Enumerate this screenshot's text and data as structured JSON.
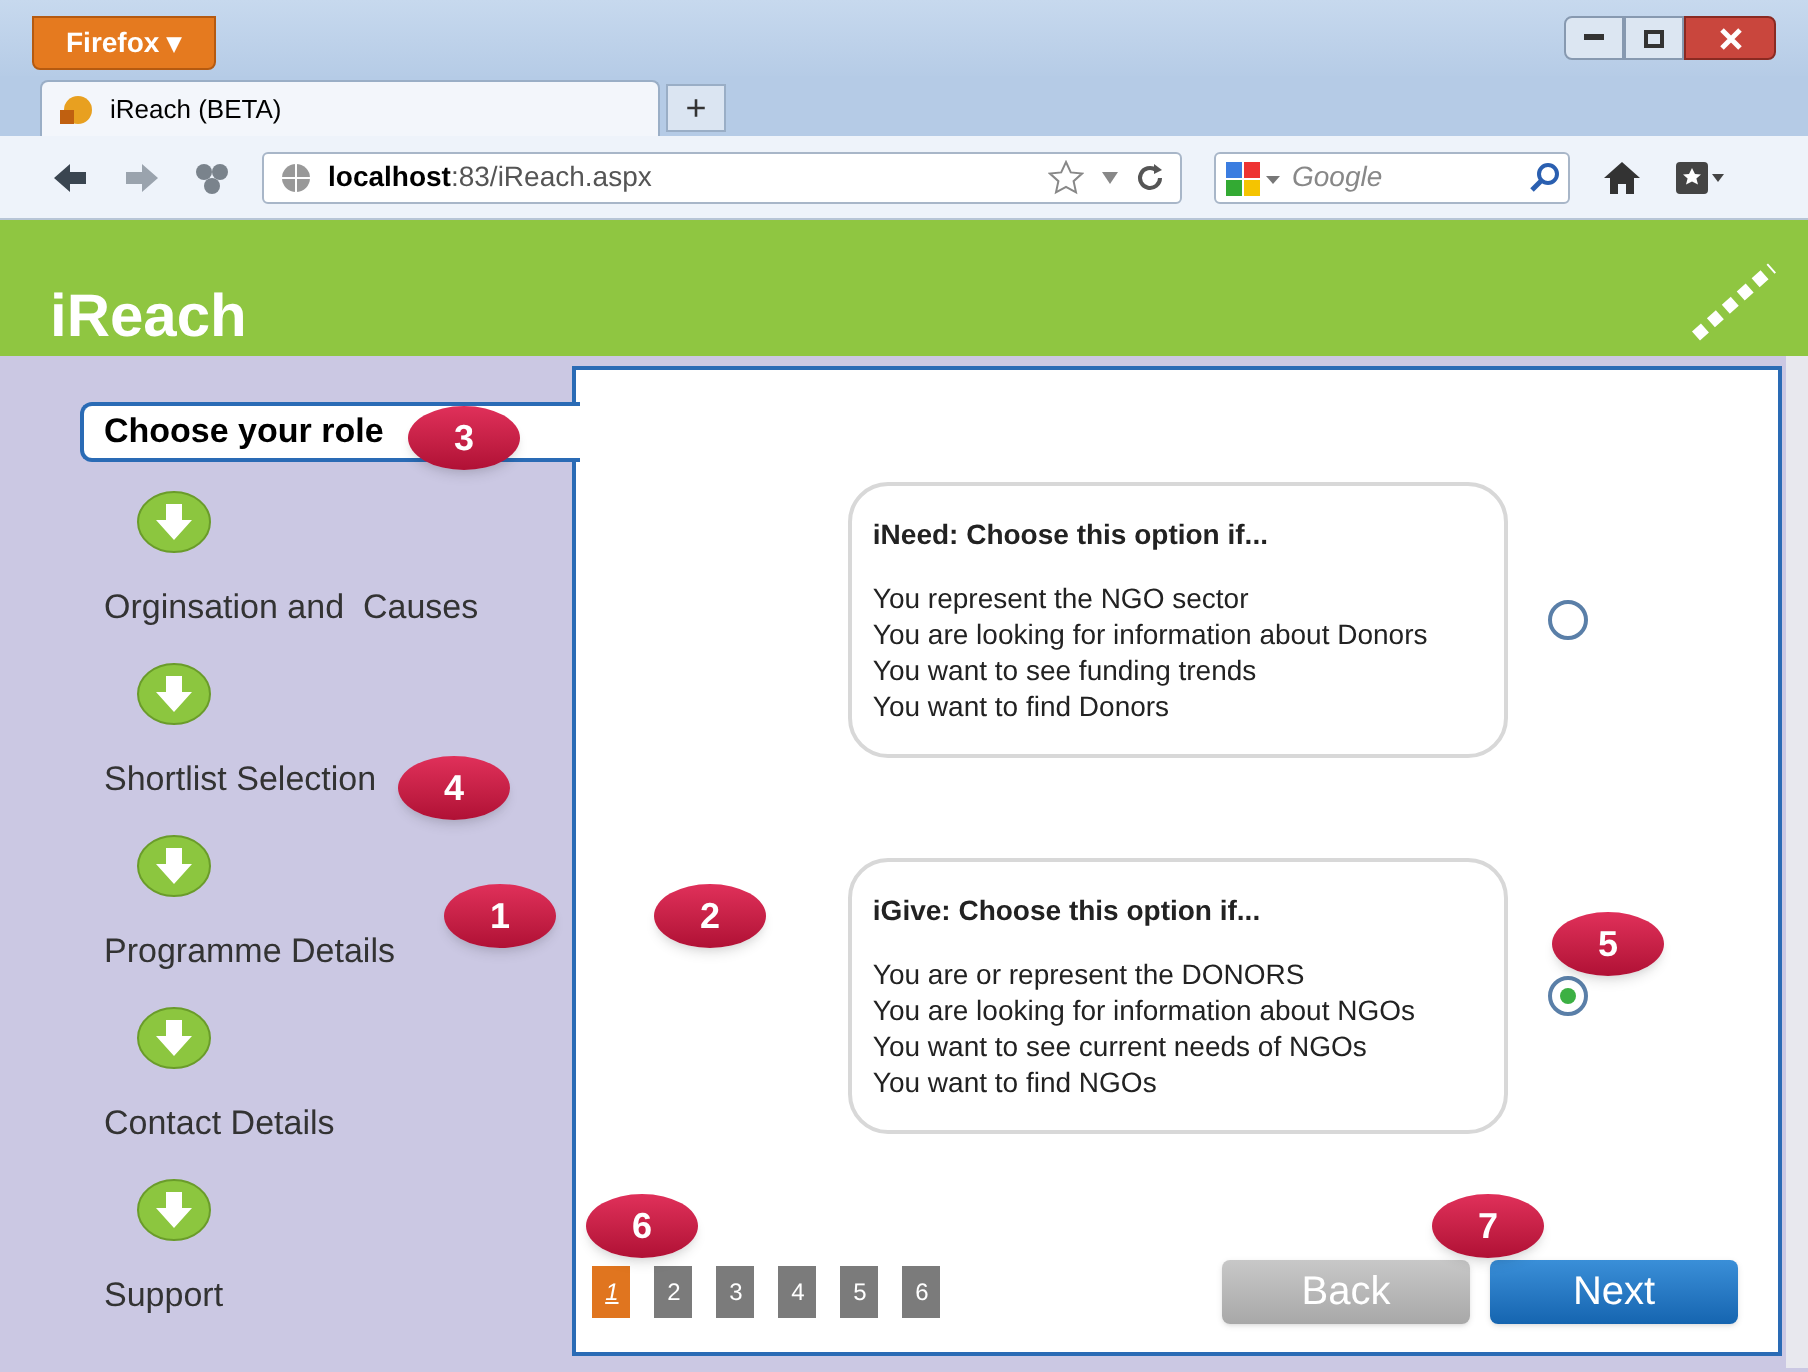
{
  "browser": {
    "menu_button": "Firefox ▾",
    "tab_title": "iReach (BETA)",
    "new_tab": "+",
    "url_host": "localhost",
    "url_rest": ":83/iReach.aspx",
    "search_placeholder": "Google"
  },
  "header": {
    "title": "iReach"
  },
  "steps": [
    {
      "label": "Choose your role",
      "selected": true
    },
    {
      "label": "Orginsation and  Causes",
      "selected": false
    },
    {
      "label": "Shortlist Selection",
      "selected": false
    },
    {
      "label": "Programme Details",
      "selected": false
    },
    {
      "label": "Contact Details",
      "selected": false
    },
    {
      "label": "Support",
      "selected": false
    }
  ],
  "options": [
    {
      "title": "iNeed: Choose this option if...",
      "lines": [
        "You represent the NGO sector",
        "You are looking for information about Donors",
        "You want to see funding trends",
        "You want to find Donors"
      ],
      "selected": false
    },
    {
      "title": "iGive: Choose this option if...",
      "lines": [
        "You are or represent the DONORS",
        "You are looking for information about NGOs",
        "You want to see current needs of NGOs",
        "You want to find NGOs"
      ],
      "selected": true
    }
  ],
  "pages": [
    {
      "label": "1",
      "selected": true
    },
    {
      "label": "2",
      "selected": false
    },
    {
      "label": "3",
      "selected": false
    },
    {
      "label": "4",
      "selected": false
    },
    {
      "label": "5",
      "selected": false
    },
    {
      "label": "6",
      "selected": false
    }
  ],
  "buttons": [
    {
      "label": "Back",
      "disabled": true
    },
    {
      "label": "Next",
      "disabled": false
    }
  ],
  "callouts": [
    {
      "label": "3",
      "kind": "role"
    },
    {
      "label": "4",
      "kind": "shortlist"
    },
    {
      "label": "1",
      "kind": "sidebar"
    },
    {
      "label": "2",
      "kind": "main"
    },
    {
      "label": "5",
      "kind": "radio"
    },
    {
      "label": "6",
      "kind": "pages"
    },
    {
      "label": "7",
      "kind": "next"
    }
  ]
}
